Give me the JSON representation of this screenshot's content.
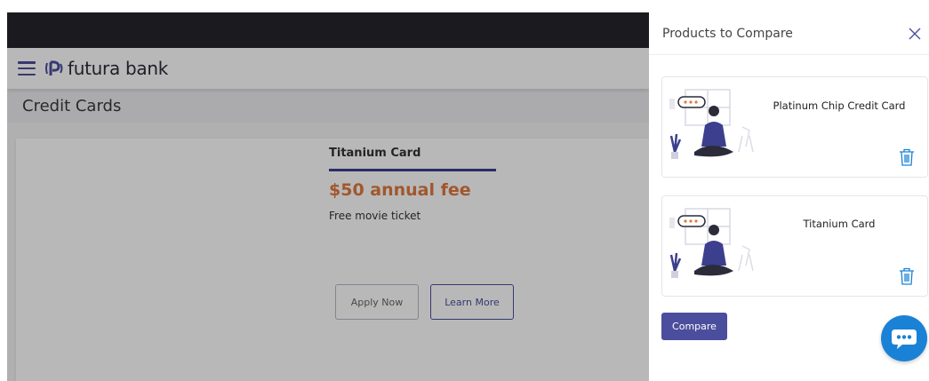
{
  "header": {
    "brand": "futura bank"
  },
  "page": {
    "title": "Credit Cards"
  },
  "card": {
    "name": "Titanium Card",
    "fee": "$50 annual fee",
    "benefit": "Free movie ticket",
    "apply_label": "Apply Now",
    "learn_label": "Learn More"
  },
  "compare_panel": {
    "title": "Products to Compare",
    "items": [
      {
        "name": "Platinum Chip Credit Card"
      },
      {
        "name": "Titanium Card"
      }
    ],
    "compare_label": "Compare"
  },
  "colors": {
    "brand": "#4b4e9c",
    "fee": "#e0793f",
    "chat": "#1a82d6",
    "topbar": "#26262c"
  },
  "icons": [
    "menu-icon",
    "futura-logo-icon",
    "close-icon",
    "trash-icon",
    "chat-icon"
  ]
}
